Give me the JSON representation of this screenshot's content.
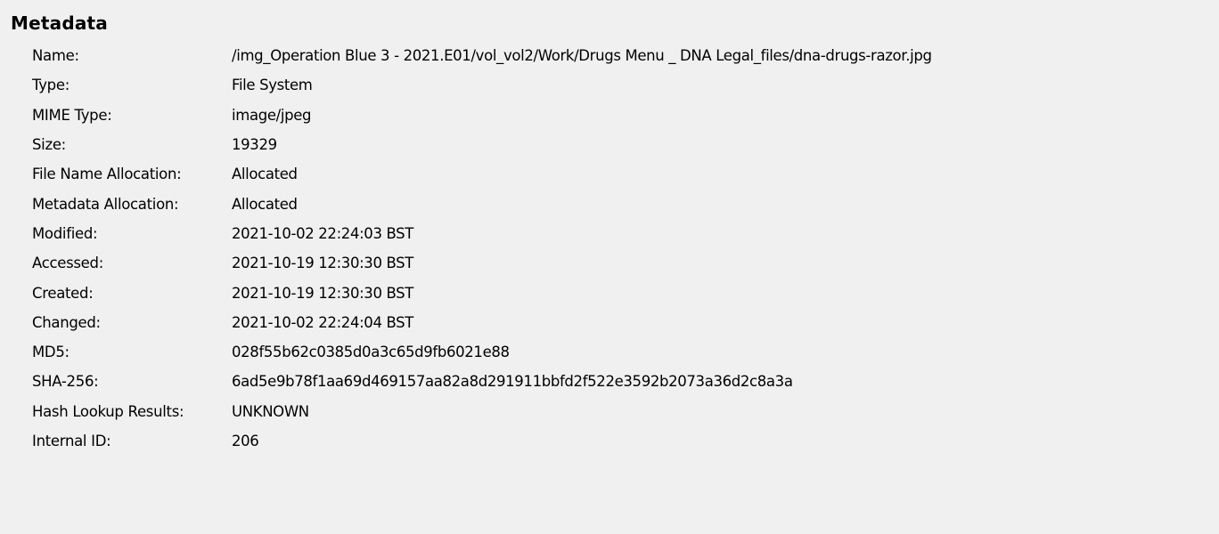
{
  "panel": {
    "title": "Metadata"
  },
  "rows": [
    {
      "label": "Name:",
      "value": "/img_Operation Blue 3 - 2021.E01/vol_vol2/Work/Drugs Menu _ DNA Legal_files/dna-drugs-razor.jpg"
    },
    {
      "label": "Type:",
      "value": "File System"
    },
    {
      "label": "MIME Type:",
      "value": "image/jpeg"
    },
    {
      "label": "Size:",
      "value": "19329"
    },
    {
      "label": "File Name Allocation:",
      "value": "Allocated"
    },
    {
      "label": "Metadata Allocation:",
      "value": "Allocated"
    },
    {
      "label": "Modified:",
      "value": "2021-10-02 22:24:03 BST"
    },
    {
      "label": "Accessed:",
      "value": "2021-10-19 12:30:30 BST"
    },
    {
      "label": "Created:",
      "value": "2021-10-19 12:30:30 BST"
    },
    {
      "label": "Changed:",
      "value": "2021-10-02 22:24:04 BST"
    },
    {
      "label": "MD5:",
      "value": "028f55b62c0385d0a3c65d9fb6021e88"
    },
    {
      "label": "SHA-256:",
      "value": "6ad5e9b78f1aa69d469157aa82a8d291911bbfd2f522e3592b2073a36d2c8a3a"
    },
    {
      "label": "Hash Lookup Results:",
      "value": "UNKNOWN"
    },
    {
      "label": "Internal ID:",
      "value": "206"
    }
  ]
}
